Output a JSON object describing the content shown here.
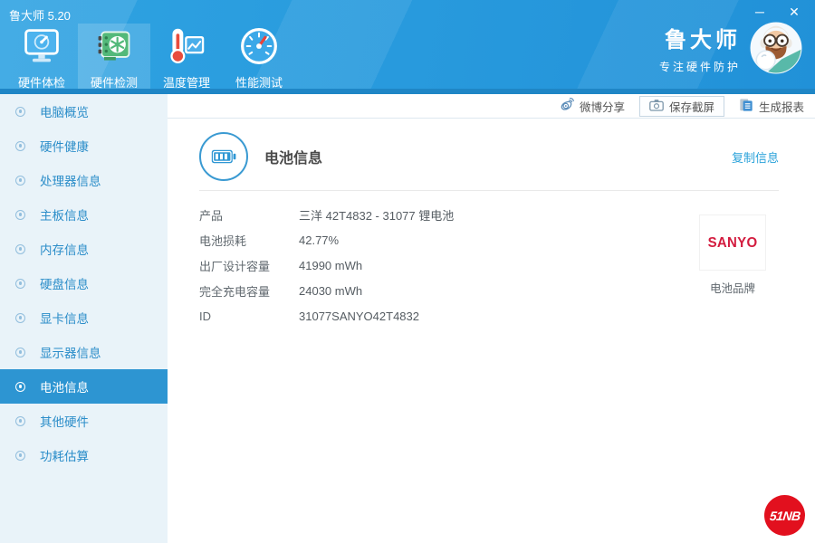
{
  "window": {
    "title": "鲁大师 5.20",
    "minimize_glyph": "─",
    "close_glyph": "✕"
  },
  "header": {
    "tabs": [
      {
        "label": "硬件体检",
        "active": false
      },
      {
        "label": "硬件检测",
        "active": true
      },
      {
        "label": "温度管理",
        "active": false
      },
      {
        "label": "性能测试",
        "active": false
      }
    ],
    "brand": {
      "name": "鲁大师",
      "slogan": "专注硬件防护"
    }
  },
  "toolbar": {
    "share_label": "微博分享",
    "screenshot_label": "保存截屏",
    "report_label": "生成报表"
  },
  "sidebar": {
    "items": [
      {
        "label": "电脑概览",
        "selected": false
      },
      {
        "label": "硬件健康",
        "selected": false
      },
      {
        "label": "处理器信息",
        "selected": false
      },
      {
        "label": "主板信息",
        "selected": false
      },
      {
        "label": "内存信息",
        "selected": false
      },
      {
        "label": "硬盘信息",
        "selected": false
      },
      {
        "label": "显卡信息",
        "selected": false
      },
      {
        "label": "显示器信息",
        "selected": false
      },
      {
        "label": "电池信息",
        "selected": true
      },
      {
        "label": "其他硬件",
        "selected": false
      },
      {
        "label": "功耗估算",
        "selected": false
      }
    ]
  },
  "content": {
    "title": "电池信息",
    "copy_link": "复制信息",
    "rows": [
      {
        "label": "产品",
        "value": "三洋 42T4832 - 31077 锂电池"
      },
      {
        "label": "电池损耗",
        "value": "42.77%"
      },
      {
        "label": "出厂设计容量",
        "value": "41990 mWh"
      },
      {
        "label": "完全充电容量",
        "value": "24030 mWh"
      },
      {
        "label": "ID",
        "value": "31077SANYO42T4832"
      }
    ],
    "brand_box": {
      "logo_text": "SANYO",
      "caption": "电池品牌"
    }
  },
  "watermark": {
    "text": "51NB"
  },
  "colors": {
    "header_blue": "#2a9ade",
    "accent_blue": "#2d95d2",
    "sidebar_bg": "#e9f3f9",
    "link_blue": "#2aa2da",
    "sanyo_red": "#d31c3f",
    "watermark_red": "#e2101e"
  }
}
